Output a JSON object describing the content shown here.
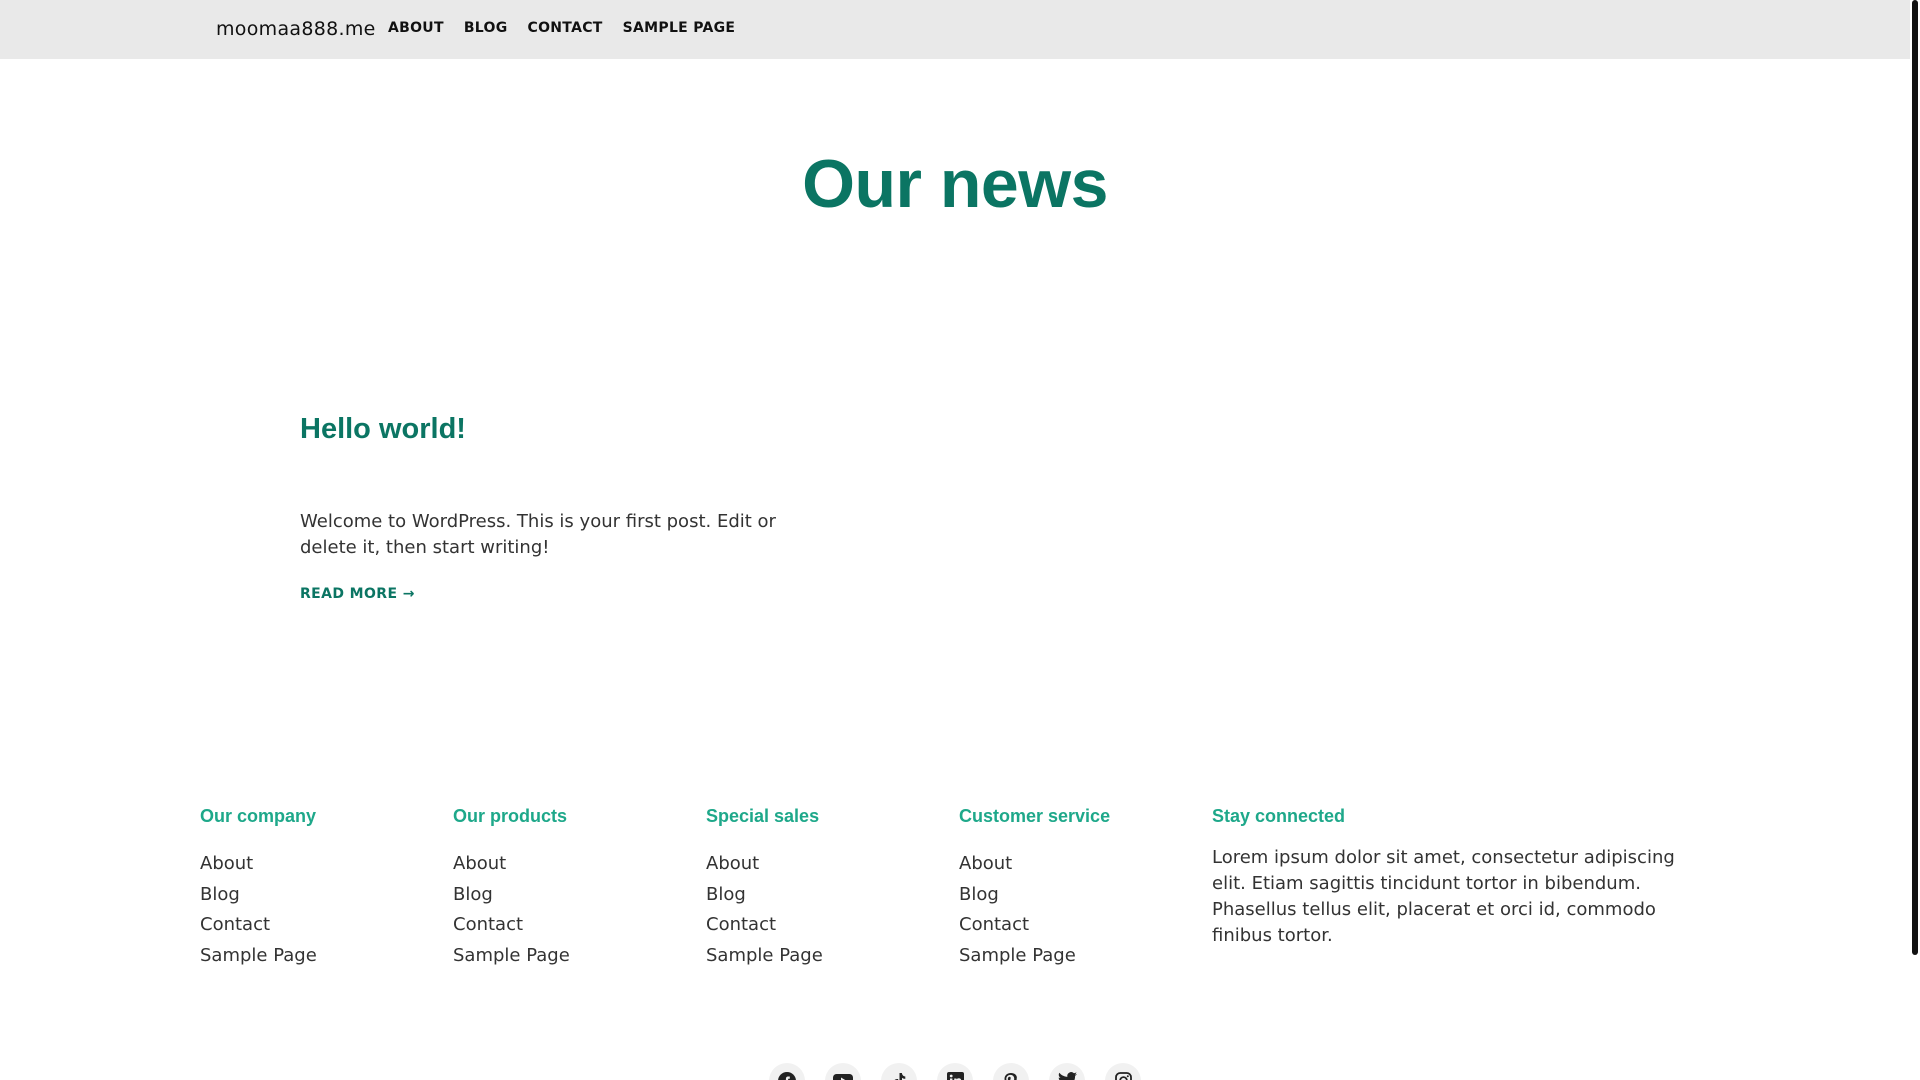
{
  "header": {
    "site_title": "moomaa888.me",
    "nav": [
      "ABOUT",
      "BLOG",
      "CONTACT",
      "SAMPLE PAGE"
    ]
  },
  "hero": {
    "title": "Our news"
  },
  "post": {
    "title": "Hello world!",
    "excerpt": "Welcome to WordPress. This is your first post. Edit or delete it, then start writing!",
    "read_more": "READ MORE →"
  },
  "footer": {
    "columns": [
      {
        "heading": "Our company",
        "links": [
          "About",
          "Blog",
          "Contact",
          "Sample Page"
        ]
      },
      {
        "heading": "Our products",
        "links": [
          "About",
          "Blog",
          "Contact",
          "Sample Page"
        ]
      },
      {
        "heading": "Special sales",
        "links": [
          "About",
          "Blog",
          "Contact",
          "Sample Page"
        ]
      },
      {
        "heading": "Customer service",
        "links": [
          "About",
          "Blog",
          "Contact",
          "Sample Page"
        ]
      }
    ],
    "stay_connected": {
      "heading": "Stay connected",
      "text": "Lorem ipsum dolor sit amet, consectetur adipiscing elit. Etiam sagittis tincidunt tortor in bibendum. Phasellus tellus elit, placerat et orci id, commodo finibus tortor."
    },
    "social_icons": [
      "facebook-icon",
      "youtube-icon",
      "tiktok-icon",
      "linkedin-icon",
      "pinterest-icon",
      "twitter-icon",
      "instagram-icon"
    ]
  },
  "colors": {
    "accent": "#0b7563",
    "footer_heading": "#1ea88a",
    "header_bg": "#e9e9e9"
  }
}
